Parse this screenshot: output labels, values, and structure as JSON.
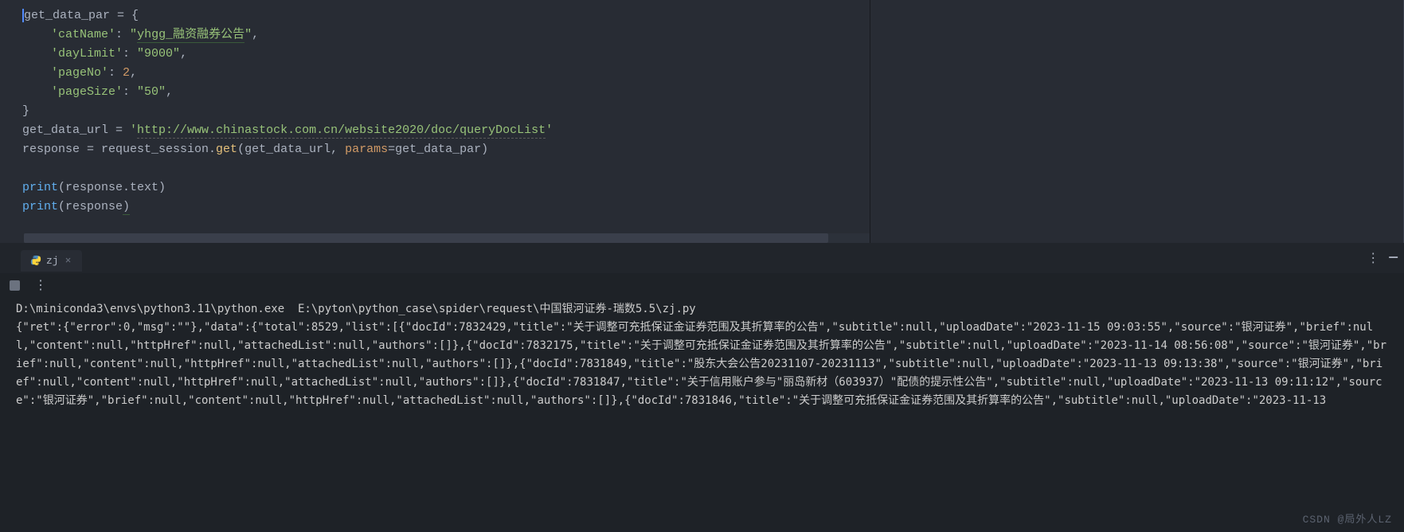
{
  "editor": {
    "lines": [
      {
        "segments": [
          {
            "text": "get_data_par = {",
            "class": "s-def cursor-mark"
          }
        ]
      },
      {
        "segments": [
          {
            "text": "    ",
            "class": ""
          },
          {
            "text": "'catName'",
            "class": "s-str"
          },
          {
            "text": ": ",
            "class": "s-op"
          },
          {
            "text": "\"",
            "class": "s-str"
          },
          {
            "text": "yhgg_融资融券公告",
            "class": "s-str underline"
          },
          {
            "text": "\"",
            "class": "s-str"
          },
          {
            "text": ",",
            "class": "s-op"
          }
        ]
      },
      {
        "segments": [
          {
            "text": "    ",
            "class": ""
          },
          {
            "text": "'dayLimit'",
            "class": "s-str"
          },
          {
            "text": ": ",
            "class": "s-op"
          },
          {
            "text": "\"9000\"",
            "class": "s-str"
          },
          {
            "text": ",",
            "class": "s-op"
          }
        ]
      },
      {
        "segments": [
          {
            "text": "    ",
            "class": ""
          },
          {
            "text": "'pageNo'",
            "class": "s-str"
          },
          {
            "text": ": ",
            "class": "s-op"
          },
          {
            "text": "2",
            "class": "s-num"
          },
          {
            "text": ",",
            "class": "s-op"
          }
        ]
      },
      {
        "segments": [
          {
            "text": "    ",
            "class": ""
          },
          {
            "text": "'pageSize'",
            "class": "s-str"
          },
          {
            "text": ": ",
            "class": "s-op"
          },
          {
            "text": "\"50\"",
            "class": "s-str"
          },
          {
            "text": ",",
            "class": "s-op"
          }
        ]
      },
      {
        "segments": [
          {
            "text": "}",
            "class": "s-brace"
          }
        ]
      },
      {
        "segments": [
          {
            "text": "get_data_url = ",
            "class": "s-def"
          },
          {
            "text": "'",
            "class": "s-str"
          },
          {
            "text": "http://www.chinastock.com.cn/website2020/doc/queryDocList",
            "class": "s-str underline-url"
          },
          {
            "text": "'",
            "class": "s-str"
          }
        ]
      },
      {
        "segments": [
          {
            "text": "response = request_session.",
            "class": "s-def"
          },
          {
            "text": "get",
            "class": "s-method"
          },
          {
            "text": "(get_data_url, ",
            "class": "s-def"
          },
          {
            "text": "params",
            "class": "s-param"
          },
          {
            "text": "=get_data_par)",
            "class": "s-def"
          }
        ]
      },
      {
        "segments": [
          {
            "text": "",
            "class": ""
          }
        ]
      },
      {
        "segments": [
          {
            "text": "print",
            "class": "s-func"
          },
          {
            "text": "(response.text)",
            "class": "s-def"
          }
        ]
      },
      {
        "segments": [
          {
            "text": "print",
            "class": "s-func"
          },
          {
            "text": "(response",
            "class": "s-def"
          },
          {
            "text": ")",
            "class": "s-def underline"
          }
        ]
      }
    ]
  },
  "tabs": {
    "active": {
      "label": "zj"
    }
  },
  "output": {
    "command": "D:\\miniconda3\\envs\\python3.11\\python.exe  E:\\pyton\\python_case\\spider\\request\\中国银河证券-瑞数5.5\\zj.py",
    "response": "{\"ret\":{\"error\":0,\"msg\":\"\"},\"data\":{\"total\":8529,\"list\":[{\"docId\":7832429,\"title\":\"关于调整可充抵保证金证券范围及其折算率的公告\",\"subtitle\":null,\"uploadDate\":\"2023-11-15 09:03:55\",\"source\":\"银河证券\",\"brief\":null,\"content\":null,\"httpHref\":null,\"attachedList\":null,\"authors\":[]},{\"docId\":7832175,\"title\":\"关于调整可充抵保证金证券范围及其折算率的公告\",\"subtitle\":null,\"uploadDate\":\"2023-11-14 08:56:08\",\"source\":\"银河证券\",\"brief\":null,\"content\":null,\"httpHref\":null,\"attachedList\":null,\"authors\":[]},{\"docId\":7831849,\"title\":\"股东大会公告20231107-20231113\",\"subtitle\":null,\"uploadDate\":\"2023-11-13 09:13:38\",\"source\":\"银河证券\",\"brief\":null,\"content\":null,\"httpHref\":null,\"attachedList\":null,\"authors\":[]},{\"docId\":7831847,\"title\":\"关于信用账户参与\"丽岛新材（603937）\"配债的提示性公告\",\"subtitle\":null,\"uploadDate\":\"2023-11-13 09:11:12\",\"source\":\"银河证券\",\"brief\":null,\"content\":null,\"httpHref\":null,\"attachedList\":null,\"authors\":[]},{\"docId\":7831846,\"title\":\"关于调整可充抵保证金证券范围及其折算率的公告\",\"subtitle\":null,\"uploadDate\":\"2023-11-13"
  },
  "watermark": "CSDN @局外人LZ"
}
